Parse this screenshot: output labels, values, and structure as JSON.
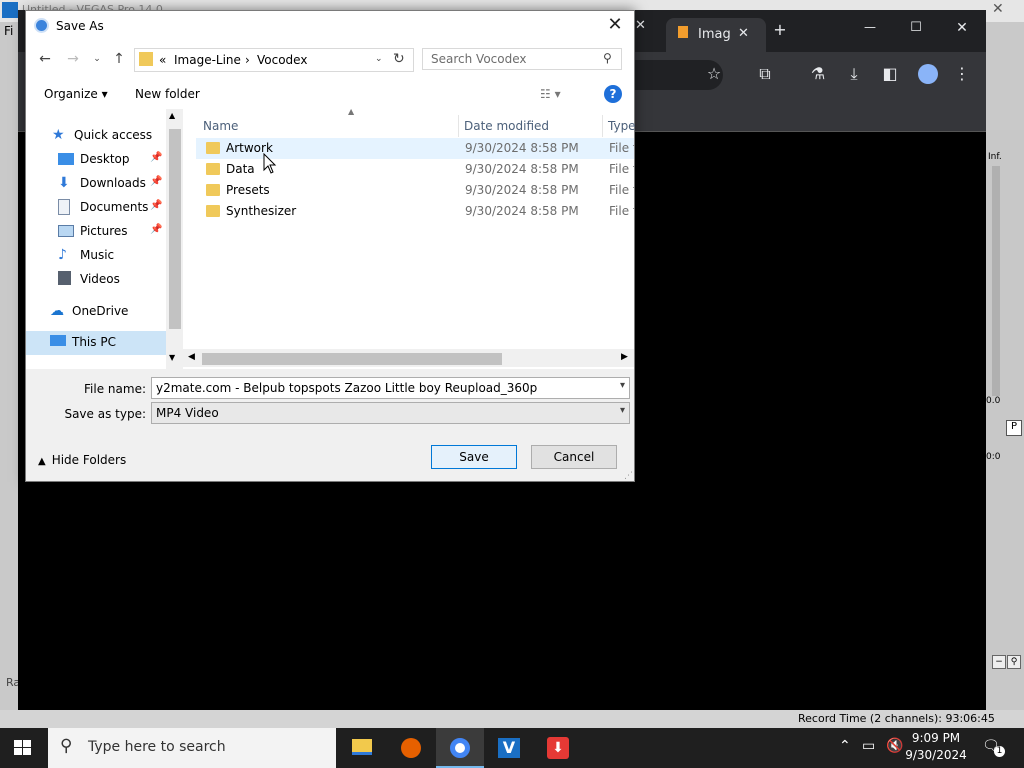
{
  "background_app": {
    "title": "Untitled - VEGAS Pro 14.0",
    "menu_first": "Fi",
    "status_text": "Record Time (2 channels): 93:06:45",
    "left_status": "Ra",
    "meter_values": [
      "Inf.",
      "0.0",
      "0:0"
    ]
  },
  "browser": {
    "tab_label": "Imag",
    "new_tab": "+",
    "window_controls": [
      "—",
      "☐",
      "✕"
    ]
  },
  "dialog": {
    "title": "Save As",
    "close": "✕",
    "address_segments": [
      "«",
      "Image-Line",
      "›",
      "Vocodex"
    ],
    "search_placeholder": "Search Vocodex",
    "organize_label": "Organize ▾",
    "new_folder_label": "New folder",
    "help": "?",
    "nav_pane": [
      {
        "label": "Quick access",
        "icon": "star-icon",
        "pinned": false
      },
      {
        "label": "Desktop",
        "icon": "desktop-icon",
        "pinned": true
      },
      {
        "label": "Downloads",
        "icon": "download-icon",
        "pinned": true
      },
      {
        "label": "Documents",
        "icon": "document-icon",
        "pinned": true
      },
      {
        "label": "Pictures",
        "icon": "picture-icon",
        "pinned": true
      },
      {
        "label": "Music",
        "icon": "music-icon",
        "pinned": false
      },
      {
        "label": "Videos",
        "icon": "video-icon",
        "pinned": false
      },
      {
        "label": "OneDrive",
        "icon": "cloud-icon",
        "pinned": false
      },
      {
        "label": "This PC",
        "icon": "computer-icon",
        "pinned": false
      }
    ],
    "columns": [
      "Name",
      "Date modified",
      "Type"
    ],
    "files": [
      {
        "name": "Artwork",
        "date": "9/30/2024 8:58 PM",
        "type": "File folder"
      },
      {
        "name": "Data",
        "date": "9/30/2024 8:58 PM",
        "type": "File folder"
      },
      {
        "name": "Presets",
        "date": "9/30/2024 8:58 PM",
        "type": "File folder"
      },
      {
        "name": "Synthesizer",
        "date": "9/30/2024 8:58 PM",
        "type": "File folder"
      }
    ],
    "file_name_label": "File name:",
    "file_name_value": "y2mate.com - Belpub topspots Zazoo  Little boy Reupload_360p",
    "save_type_label": "Save as type:",
    "save_type_value": "MP4 Video",
    "hide_folders_label": "Hide Folders",
    "save_label": "Save",
    "cancel_label": "Cancel"
  },
  "taskbar": {
    "search_placeholder": "Type here to search",
    "time": "9:09 PM",
    "date": "9/30/2024",
    "notification_count": "1"
  },
  "colors": {
    "accent": "#0078d7",
    "folder": "#f0c95a",
    "chrome_dark": "#202124",
    "taskbar": "#1f1f1f"
  }
}
